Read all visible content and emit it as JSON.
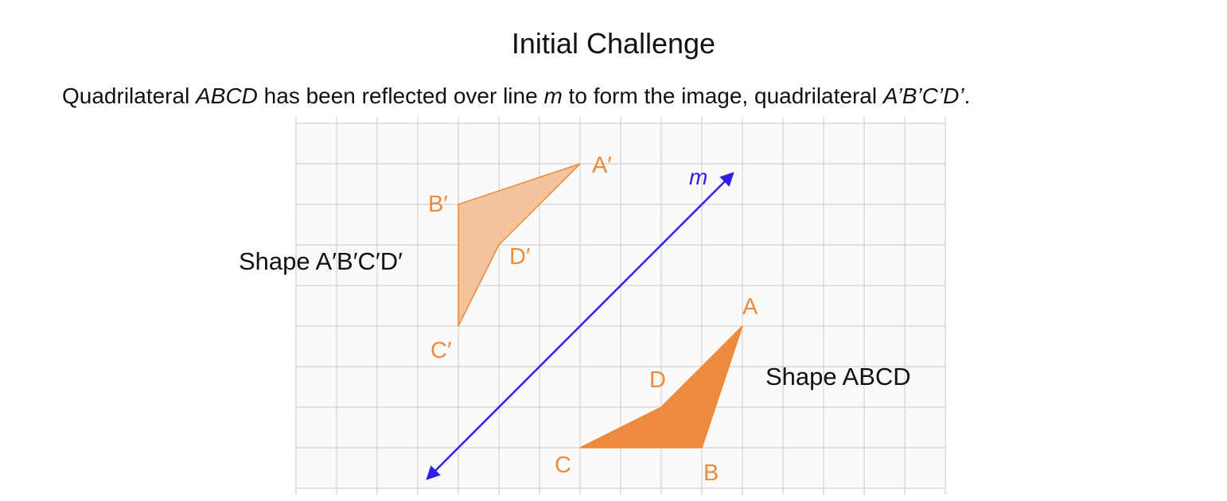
{
  "title": "Initial Challenge",
  "intro": {
    "p1": "Quadrilateral ",
    "shape": "ABCD",
    "p2": " has been reflected over line ",
    "line": "m",
    "p3": " to form the image, quadrilateral ",
    "image": "A’B’C’D’",
    "p4": "."
  },
  "diagram": {
    "grid_columns": 16,
    "grid_rows": 9,
    "line_label": "m",
    "original": {
      "name": "Shape ABCD",
      "vertices": [
        {
          "label": "A",
          "x": 11,
          "y": 4
        },
        {
          "label": "B",
          "x": 10,
          "y": 1
        },
        {
          "label": "C",
          "x": 7,
          "y": 1
        },
        {
          "label": "D",
          "x": 9,
          "y": 2
        }
      ]
    },
    "image": {
      "name": "Shape A′B′C′D′",
      "vertices": [
        {
          "label": "A′",
          "x": 7,
          "y": 8
        },
        {
          "label": "B′",
          "x": 4,
          "y": 7
        },
        {
          "label": "C′",
          "x": 4,
          "y": 4
        },
        {
          "label": "D′",
          "x": 5,
          "y": 6
        }
      ]
    },
    "colors": {
      "original_fill": "#ee8a3f",
      "image_fill": "#f4c39b",
      "image_stroke": "#ec8a3e",
      "line": "#2f1ee8",
      "grid": "#d2d2d2",
      "grid_bg": "#fafaf8"
    }
  }
}
